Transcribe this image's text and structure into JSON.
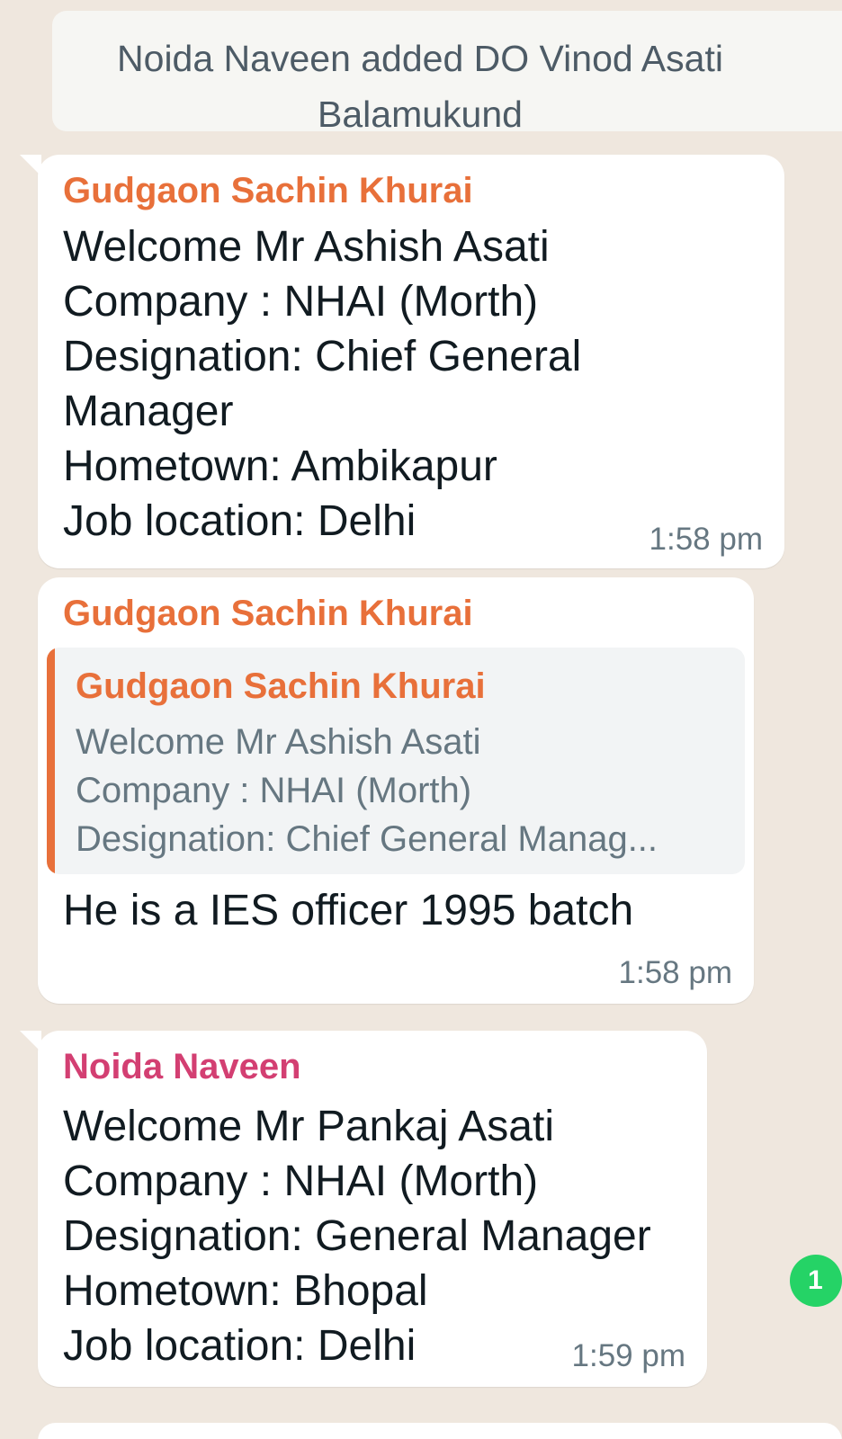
{
  "system": {
    "line1": "Noida Naveen added DO Vinod Asati",
    "line2": "Balamukund"
  },
  "messages": [
    {
      "sender": "Gudgaon Sachin Khurai",
      "sender_color": "#e8703a",
      "body": "Welcome Mr Ashish Asati\nCompany : NHAI (Morth)\nDesignation: Chief General\nManager\nHometown: Ambikapur\nJob location: Delhi",
      "time": "1:58 pm"
    },
    {
      "sender": "Gudgaon Sachin Khurai",
      "sender_color": "#e8703a",
      "quote": {
        "sender": "Gudgaon Sachin Khurai",
        "line1": "Welcome Mr Ashish Asati",
        "line2": "Company : NHAI (Morth)",
        "line3": "Designation: Chief General Manag..."
      },
      "body": "He is a IES officer 1995 batch",
      "time": "1:58 pm"
    },
    {
      "sender": "Noida Naveen",
      "sender_color": "#d33f72",
      "body": "Welcome Mr Pankaj Asati\nCompany : NHAI (Morth)\nDesignation: General Manager\nHometown: Bhopal\nJob location: Delhi",
      "time": "1:59 pm"
    }
  ],
  "unread_badge": "1"
}
